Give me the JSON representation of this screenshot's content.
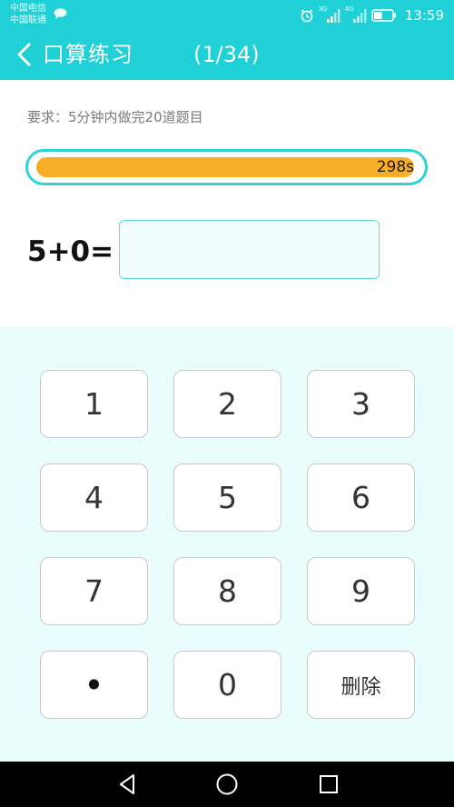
{
  "status_bar": {
    "carrier_1": "中国电信",
    "carrier_2": "中国联通",
    "network_1": "3G",
    "network_2": "4G",
    "time": "13:59",
    "icons": [
      "chat-bubble-icon",
      "alarm-clock-icon",
      "signal-icon",
      "signal-icon",
      "battery-icon"
    ],
    "battery_level": 0.45
  },
  "header": {
    "back_icon": "chevron-left-icon",
    "title": "口算练习",
    "progress": "(1/34)"
  },
  "question": {
    "requirement": "要求：5分钟内做完20道题目",
    "timer_text": "298s",
    "timer_fraction": 0.993,
    "equation": "5+0=",
    "answer_value": ""
  },
  "keypad": {
    "keys": [
      "1",
      "2",
      "3",
      "4",
      "5",
      "6",
      "7",
      "8",
      "9",
      "•",
      "0",
      "删除"
    ]
  },
  "nav_bar": {
    "icons": [
      "triangle-back-icon",
      "circle-home-icon",
      "square-recent-icon"
    ]
  },
  "colors": {
    "accent": "#1fd0d6",
    "timer_fill": "#f7ad25",
    "keypad_background": "#e9fdfd"
  }
}
